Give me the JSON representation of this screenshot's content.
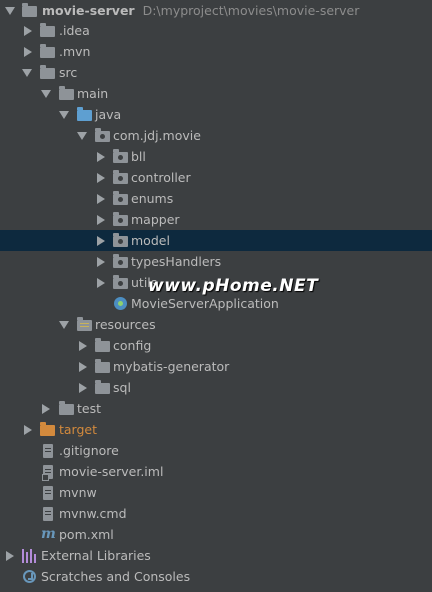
{
  "project_tree": {
    "root": {
      "name": "movie-server",
      "path": "D:\\myproject\\movies\\movie-server"
    },
    "items": {
      "idea": ".idea",
      "mvn": ".mvn",
      "src": "src",
      "main": "main",
      "java": "java",
      "package": "com.jdj.movie",
      "bll": "bll",
      "controller": "controller",
      "enums": "enums",
      "mapper": "mapper",
      "model": "model",
      "typesHandlers": "typesHandlers",
      "utils": "utils",
      "app_class": "MovieServerApplication",
      "resources": "resources",
      "config": "config",
      "mybatis_generator": "mybatis-generator",
      "sql": "sql",
      "test": "test",
      "target": "target",
      "gitignore": ".gitignore",
      "iml": "movie-server.iml",
      "mvnw": "mvnw",
      "mvnw_cmd": "mvnw.cmd",
      "pom": "pom.xml",
      "external_libraries": "External Libraries",
      "scratches": "Scratches and Consoles"
    },
    "selected_item": "model",
    "maven_glyph": "m"
  },
  "watermark": "www.pHome.NET",
  "colors": {
    "background": "#3c3f41",
    "selection": "#0d293e",
    "text": "#bbbbbb",
    "source_folder": "#5e9fd1",
    "excluded_folder": "#d38a3d"
  }
}
